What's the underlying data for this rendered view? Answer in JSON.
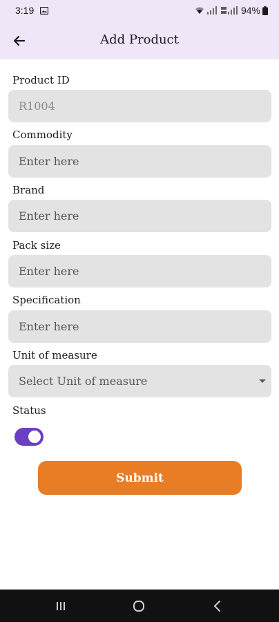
{
  "status_bar": {
    "time": "3:19",
    "battery": "94%"
  },
  "app_bar": {
    "title": "Add Product"
  },
  "form": {
    "product_id": {
      "label": "Product ID",
      "value": "R1004"
    },
    "commodity": {
      "label": "Commodity",
      "placeholder": "Enter here"
    },
    "brand": {
      "label": "Brand",
      "placeholder": "Enter here"
    },
    "pack_size": {
      "label": "Pack size",
      "placeholder": "Enter here"
    },
    "specification": {
      "label": "Specification",
      "placeholder": "Enter here"
    },
    "unit_of_measure": {
      "label": "Unit of measure",
      "selected": "Select Unit of measure"
    },
    "status": {
      "label": "Status",
      "enabled": true
    }
  },
  "submit": {
    "label": "Submit"
  },
  "colors": {
    "header_bg": "#efe6f7",
    "field_bg": "#e3e3e3",
    "toggle_on": "#6a3fc4",
    "submit_bg": "#e87d26",
    "nav_bar_bg": "#111111"
  },
  "icons": {
    "back": "arrow-left-icon",
    "gallery": "gallery-icon",
    "wifi": "wifi-icon",
    "signal": "signal-icon",
    "recents": "recents-icon",
    "home": "home-icon",
    "nav_back": "chevron-left-icon"
  }
}
